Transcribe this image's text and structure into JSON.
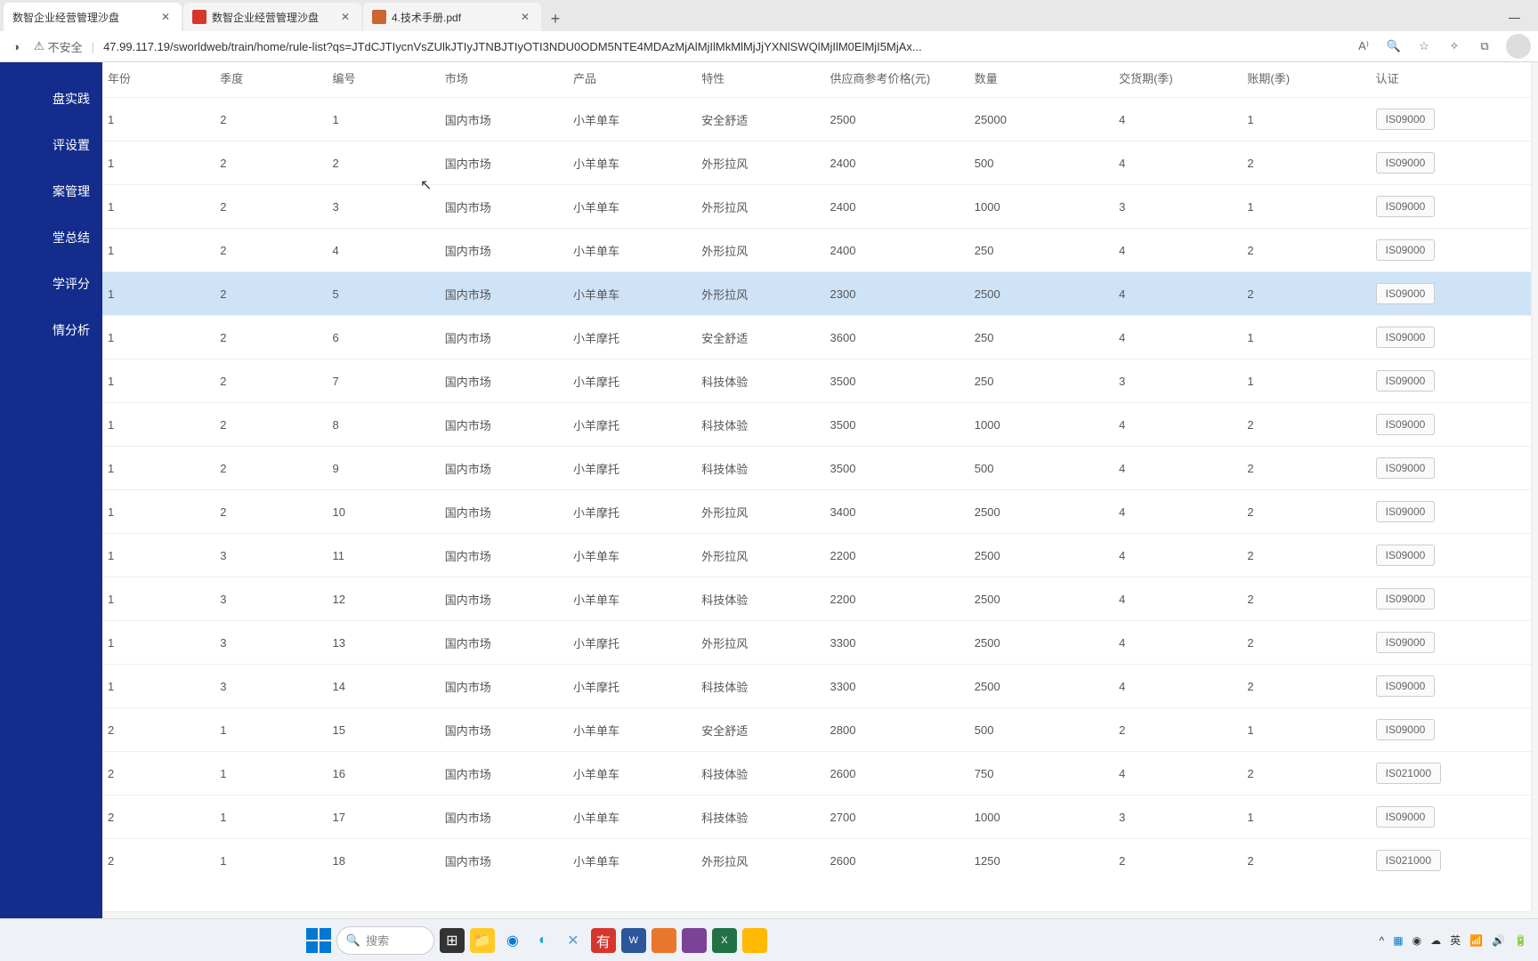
{
  "browser": {
    "tabs": [
      {
        "title": "数智企业经营管理沙盘",
        "active": true
      },
      {
        "title": "数智企业经营管理沙盘",
        "active": false
      },
      {
        "title": "4.技术手册.pdf",
        "active": false
      }
    ],
    "insecure_label": "不安全",
    "url": "47.99.117.19/sworldweb/train/home/rule-list?qs=JTdCJTIycnVsZUlkJTIyJTNBJTIyOTI3NDU0ODM5NTE4MDAzMjAlMjIlMkMlMjJjYXNlSWQlMjIlM0ElMjI5MjAx..."
  },
  "sidebar": {
    "items": [
      "盘实践",
      "评设置",
      "案管理",
      "堂总结",
      "学评分",
      "情分析"
    ]
  },
  "table": {
    "headers": [
      "年份",
      "季度",
      "编号",
      "市场",
      "产品",
      "特性",
      "供应商参考价格(元)",
      "数量",
      "交货期(季)",
      "账期(季)",
      "认证"
    ],
    "rows": [
      {
        "y": "1",
        "q": "2",
        "id": "1",
        "mkt": "国内市场",
        "prod": "小羊单车",
        "feat": "安全舒适",
        "price": "2500",
        "qty": "25000",
        "lead": "4",
        "pay": "1",
        "cert": "IS09000"
      },
      {
        "y": "1",
        "q": "2",
        "id": "2",
        "mkt": "国内市场",
        "prod": "小羊单车",
        "feat": "外形拉风",
        "price": "2400",
        "qty": "500",
        "lead": "4",
        "pay": "2",
        "cert": "IS09000"
      },
      {
        "y": "1",
        "q": "2",
        "id": "3",
        "mkt": "国内市场",
        "prod": "小羊单车",
        "feat": "外形拉风",
        "price": "2400",
        "qty": "1000",
        "lead": "3",
        "pay": "1",
        "cert": "IS09000"
      },
      {
        "y": "1",
        "q": "2",
        "id": "4",
        "mkt": "国内市场",
        "prod": "小羊单车",
        "feat": "外形拉风",
        "price": "2400",
        "qty": "250",
        "lead": "4",
        "pay": "2",
        "cert": "IS09000"
      },
      {
        "y": "1",
        "q": "2",
        "id": "5",
        "mkt": "国内市场",
        "prod": "小羊单车",
        "feat": "外形拉风",
        "price": "2300",
        "qty": "2500",
        "lead": "4",
        "pay": "2",
        "cert": "IS09000",
        "hl": true
      },
      {
        "y": "1",
        "q": "2",
        "id": "6",
        "mkt": "国内市场",
        "prod": "小羊摩托",
        "feat": "安全舒适",
        "price": "3600",
        "qty": "250",
        "lead": "4",
        "pay": "1",
        "cert": "IS09000"
      },
      {
        "y": "1",
        "q": "2",
        "id": "7",
        "mkt": "国内市场",
        "prod": "小羊摩托",
        "feat": "科技体验",
        "price": "3500",
        "qty": "250",
        "lead": "3",
        "pay": "1",
        "cert": "IS09000"
      },
      {
        "y": "1",
        "q": "2",
        "id": "8",
        "mkt": "国内市场",
        "prod": "小羊摩托",
        "feat": "科技体验",
        "price": "3500",
        "qty": "1000",
        "lead": "4",
        "pay": "2",
        "cert": "IS09000"
      },
      {
        "y": "1",
        "q": "2",
        "id": "9",
        "mkt": "国内市场",
        "prod": "小羊摩托",
        "feat": "科技体验",
        "price": "3500",
        "qty": "500",
        "lead": "4",
        "pay": "2",
        "cert": "IS09000"
      },
      {
        "y": "1",
        "q": "2",
        "id": "10",
        "mkt": "国内市场",
        "prod": "小羊摩托",
        "feat": "外形拉风",
        "price": "3400",
        "qty": "2500",
        "lead": "4",
        "pay": "2",
        "cert": "IS09000"
      },
      {
        "y": "1",
        "q": "3",
        "id": "11",
        "mkt": "国内市场",
        "prod": "小羊单车",
        "feat": "外形拉风",
        "price": "2200",
        "qty": "2500",
        "lead": "4",
        "pay": "2",
        "cert": "IS09000"
      },
      {
        "y": "1",
        "q": "3",
        "id": "12",
        "mkt": "国内市场",
        "prod": "小羊单车",
        "feat": "科技体验",
        "price": "2200",
        "qty": "2500",
        "lead": "4",
        "pay": "2",
        "cert": "IS09000"
      },
      {
        "y": "1",
        "q": "3",
        "id": "13",
        "mkt": "国内市场",
        "prod": "小羊摩托",
        "feat": "外形拉风",
        "price": "3300",
        "qty": "2500",
        "lead": "4",
        "pay": "2",
        "cert": "IS09000"
      },
      {
        "y": "1",
        "q": "3",
        "id": "14",
        "mkt": "国内市场",
        "prod": "小羊摩托",
        "feat": "科技体验",
        "price": "3300",
        "qty": "2500",
        "lead": "4",
        "pay": "2",
        "cert": "IS09000"
      },
      {
        "y": "2",
        "q": "1",
        "id": "15",
        "mkt": "国内市场",
        "prod": "小羊单车",
        "feat": "安全舒适",
        "price": "2800",
        "qty": "500",
        "lead": "2",
        "pay": "1",
        "cert": "IS09000"
      },
      {
        "y": "2",
        "q": "1",
        "id": "16",
        "mkt": "国内市场",
        "prod": "小羊单车",
        "feat": "科技体验",
        "price": "2600",
        "qty": "750",
        "lead": "4",
        "pay": "2",
        "cert": "IS021000"
      },
      {
        "y": "2",
        "q": "1",
        "id": "17",
        "mkt": "国内市场",
        "prod": "小羊单车",
        "feat": "科技体验",
        "price": "2700",
        "qty": "1000",
        "lead": "3",
        "pay": "1",
        "cert": "IS09000"
      },
      {
        "y": "2",
        "q": "1",
        "id": "18",
        "mkt": "国内市场",
        "prod": "小羊单车",
        "feat": "外形拉风",
        "price": "2600",
        "qty": "1250",
        "lead": "2",
        "pay": "2",
        "cert": "IS021000"
      }
    ]
  },
  "taskbar": {
    "search_placeholder": "搜索",
    "ime": "英"
  }
}
